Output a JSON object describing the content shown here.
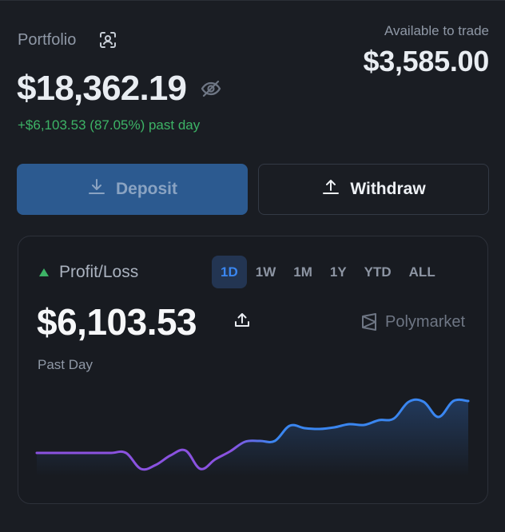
{
  "header": {
    "portfolio_label": "Portfolio",
    "balance": "$18,362.19",
    "change": "+$6,103.53 (87.05%) past day",
    "available_label": "Available to trade",
    "available_value": "$3,585.00"
  },
  "actions": {
    "deposit_label": "Deposit",
    "withdraw_label": "Withdraw"
  },
  "pnl": {
    "title": "Profit/Loss",
    "value": "$6,103.53",
    "brand": "Polymarket",
    "range_label": "Past Day",
    "tabs": [
      "1D",
      "1W",
      "1M",
      "1Y",
      "YTD",
      "ALL"
    ],
    "active_tab": "1D"
  },
  "colors": {
    "positive": "#3db366",
    "accent": "#3a86f0",
    "line_start": "#8a52e0",
    "line_end": "#3a86f0"
  },
  "chart_data": {
    "type": "area",
    "y": [
      0,
      0,
      0,
      0,
      0,
      0,
      0,
      -20,
      -15,
      -3,
      3,
      -20,
      -8,
      2,
      14,
      15,
      15,
      34,
      31,
      30,
      32,
      36,
      35,
      41,
      43,
      64,
      64,
      45,
      65,
      65
    ]
  }
}
